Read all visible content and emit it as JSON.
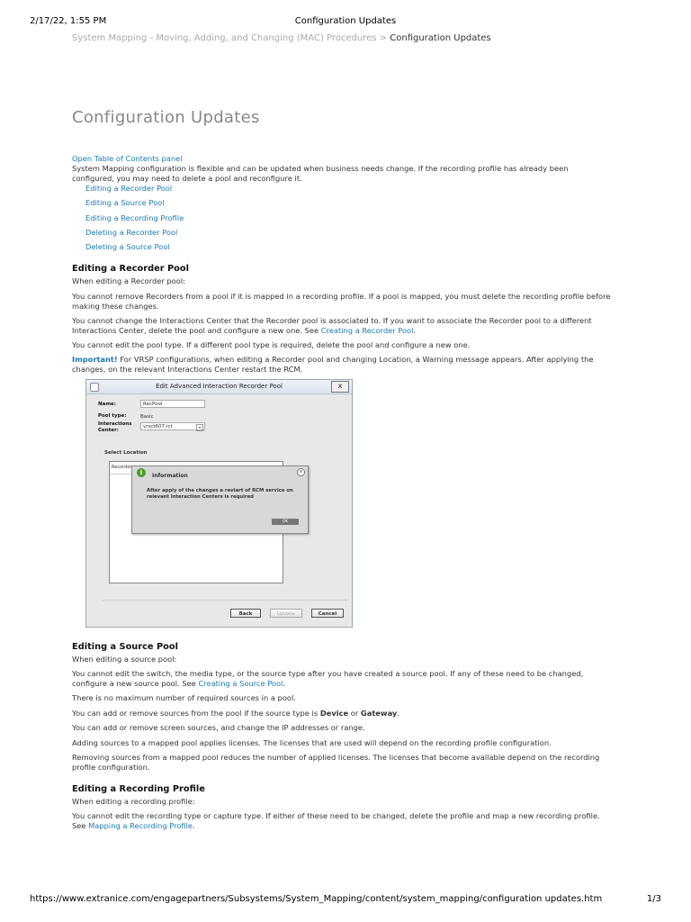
{
  "print_header": {
    "date": "2/17/22, 1:55 PM",
    "title": "Configuration Updates"
  },
  "breadcrumb": {
    "parent": "System Mapping - Moving, Adding, and Changing (MAC) Procedures",
    "separator": " > ",
    "current": "Configuration Updates"
  },
  "page_title": "Configuration Updates",
  "toc_toggle": "Open Table of Contents panel",
  "intro": "System Mapping configuration is flexible and can be updated when business needs change. If the recording profile has already been configured, you may need to delete a pool and reconfigure it.",
  "toc": [
    {
      "label": "Editing a Recorder Pool"
    },
    {
      "label": "Editing a Source Pool"
    },
    {
      "label": "Editing a Recording Profile"
    },
    {
      "label": "Deleting a Recorder Pool"
    },
    {
      "label": "Deleting a Source Pool"
    }
  ],
  "recorder_pool": {
    "heading": "Editing a Recorder Pool",
    "lead": "When editing a Recorder pool:",
    "p1": "You cannot remove Recorders from a pool if it is mapped in a recording profile. If a pool is mapped, you must delete the recording profile before making these changes.",
    "p2_text": "You cannot change the Interactions Center that the Recorder pool is associated to. If you want to associate the Recorder pool to a different Interactions Center, delete the pool and configure a new one. See ",
    "p2_link": "Creating a Recorder Pool",
    "p2_end": ".",
    "p3": "You cannot edit the pool type. If a different pool type is required, delete the pool and configure a new one.",
    "important_label": "Important!",
    "important_text": " For VRSP configurations, when editing a Recorder pool and changing Location, a Warning message appears. After applying the changes, on the relevant Interactions Center restart the RCM."
  },
  "dialog": {
    "title": "Edit Advanced Interaction Recorder Pool",
    "close_glyph": "x",
    "name_label": "Name:",
    "name_value": "RecPool",
    "pool_type_label": "Pool type:",
    "pool_type_value": "Basic",
    "ic_label_1": "Interactions",
    "ic_label_2": "Center:",
    "ic_value": "vrsct607-ict",
    "select_location": "Select Location",
    "list_header": "Recorder",
    "buttons": {
      "back": "Back",
      "update": "Update",
      "cancel": "Cancel"
    },
    "info": {
      "icon_glyph": "i",
      "title": "Information",
      "close_glyph": "x",
      "message": "After apply of the changes a restart of RCM service on relevant Interaction Centers is required",
      "ok": "OK"
    }
  },
  "source_pool": {
    "heading": "Editing a Source Pool",
    "lead": "When editing a source pool:",
    "p1_text": "You cannot edit the switch, the media type, or the source type after you have created a source pool. If any of these need to be changed, configure a new source pool. See ",
    "p1_link": "Creating a Source Pool",
    "p1_end": ".",
    "p2": "There is no maximum number of required sources in a pool.",
    "s1_text": "You can add or remove sources from the pool if the source type is ",
    "s1_bold1": "Device",
    "s1_or": " or ",
    "s1_bold2": "Gateway",
    "s1_end": ".",
    "s2": "You can add or remove screen sources, and change the IP addresses or range.",
    "s3": "Adding sources to a mapped pool applies licenses. The licenses that are used will depend on the recording profile configuration.",
    "s4": "Removing sources from a mapped pool reduces the number of applied licenses. The licenses that become available depend on the recording profile configuration."
  },
  "recording_profile": {
    "heading": "Editing a Recording Profile",
    "lead": "When editing a recording profile:",
    "p1_text": "You cannot edit the recording type or capture type. If either of these need to be changed, delete the profile and map a new recording profile. See ",
    "p1_link": "Mapping a Recording Profile",
    "p1_end": "."
  },
  "print_footer": {
    "url": "https://www.extranice.com/engagepartners/Subsystems/System_Mapping/content/system_mapping/configuration updates.htm",
    "page": "1/3"
  }
}
